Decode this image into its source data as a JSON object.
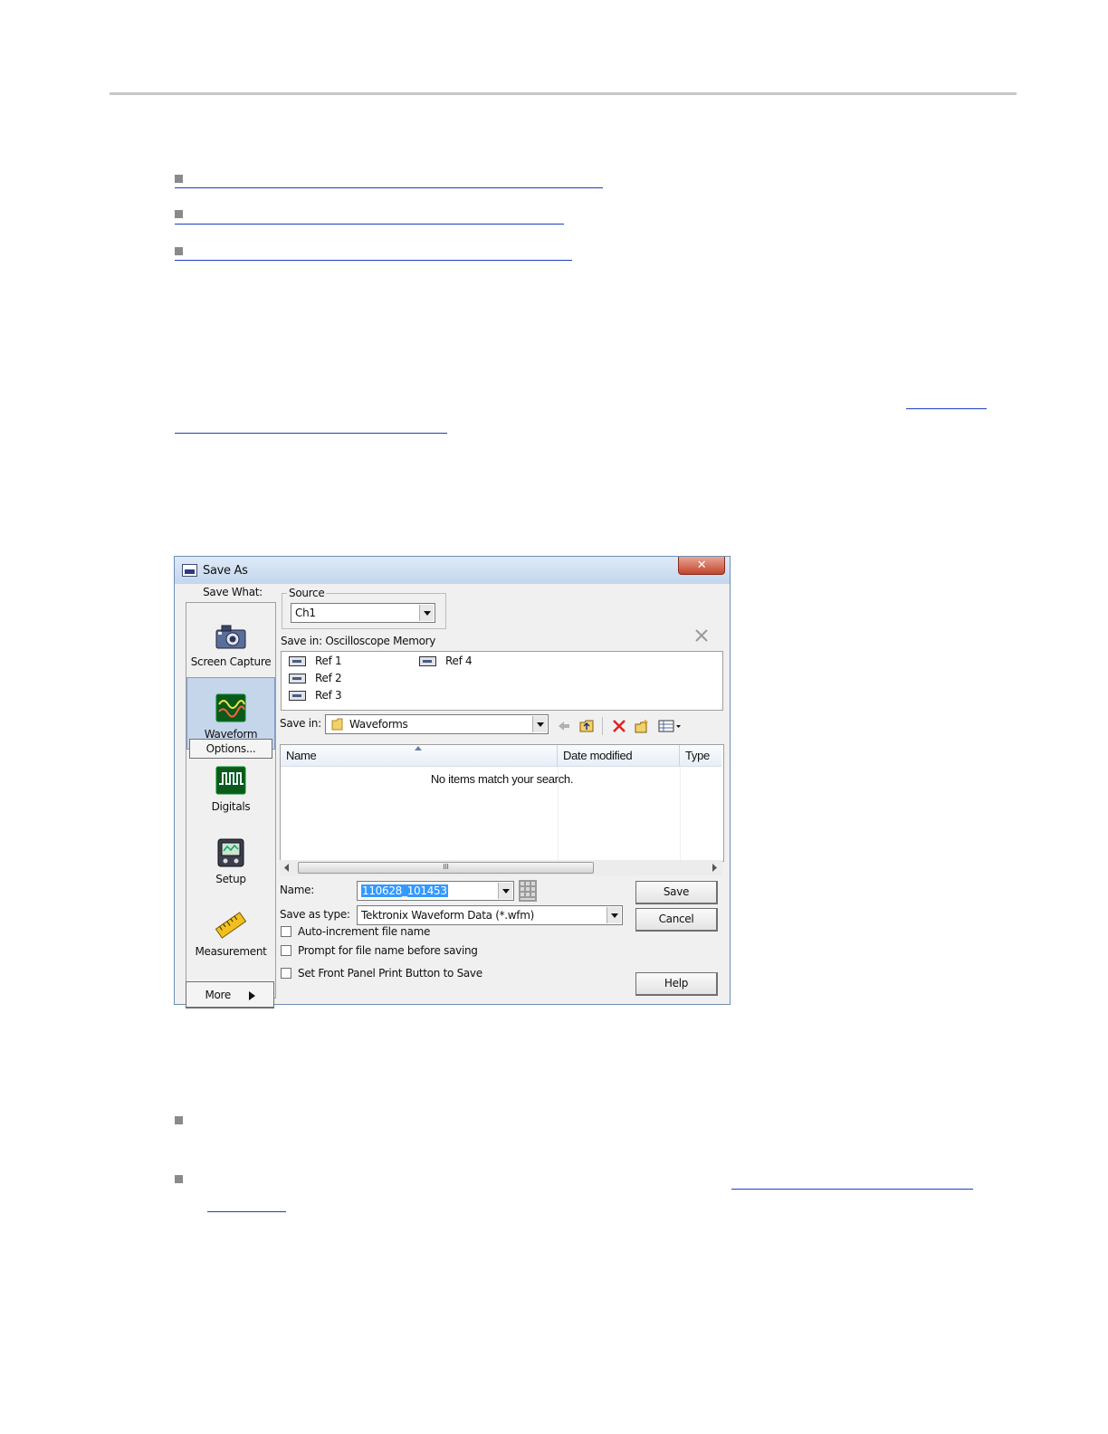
{
  "dialog": {
    "title": "Save As",
    "close_glyph": "✕",
    "save_what_label": "Save What:",
    "categories": [
      {
        "label": "Screen Capture",
        "icon": "camera-icon"
      },
      {
        "label": "Waveform",
        "icon": "waveform-icon",
        "selected": true
      },
      {
        "label": "Digitals",
        "icon": "digital-waveform-icon"
      },
      {
        "label": "Setup",
        "icon": "setup-icon"
      },
      {
        "label": "Measurement",
        "icon": "measurement-ruler-icon"
      }
    ],
    "options_label": "Options...",
    "more_label": "More",
    "source": {
      "label": "Source",
      "value": "Ch1"
    },
    "save_in_memory_label": "Save in: Oscilloscope Memory",
    "refs": [
      "Ref 1",
      "Ref 2",
      "Ref 3",
      "Ref 4"
    ],
    "save_in_label": "Save in:",
    "folder": "Waveforms",
    "columns": [
      "Name",
      "Date modified",
      "Type"
    ],
    "empty_message": "No items match your search.",
    "scroll_thumb_glyph": "III",
    "name_label": "Name:",
    "name_value": "110628_101453",
    "save_as_type_label": "Save as type:",
    "save_as_type_value": "Tektronix Waveform Data (*.wfm)",
    "checkboxes": [
      {
        "label": "Auto-increment file name",
        "checked": false
      },
      {
        "label": "Prompt for file name before saving",
        "checked": false
      },
      {
        "label": "Set Front Panel Print Button to Save",
        "checked": false
      }
    ],
    "buttons": {
      "save": "Save",
      "cancel": "Cancel",
      "help": "Help"
    }
  }
}
